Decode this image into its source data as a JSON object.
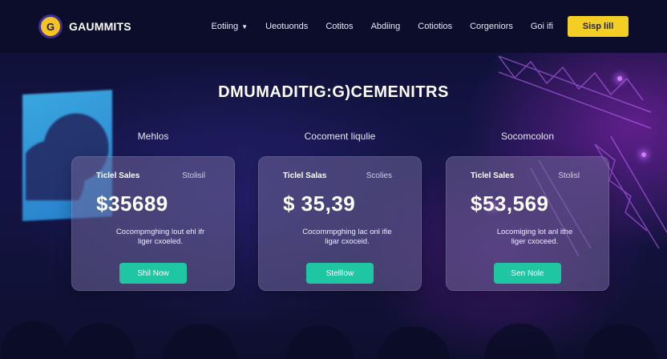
{
  "brand": {
    "logo_letter": "G",
    "name": "GAUMMITS"
  },
  "nav": {
    "items": [
      {
        "label": "Eotiing",
        "dropdown": true
      },
      {
        "label": "Ueotuonds"
      },
      {
        "label": "Cotitos"
      },
      {
        "label": "Abdiing"
      },
      {
        "label": "Cotiotios"
      },
      {
        "label": "Corgeniors"
      },
      {
        "label": "Goi ifi"
      }
    ],
    "signup_label": "Sisp lill"
  },
  "page_title": "DMUMADITIG:G)CEMENITRS",
  "columns": [
    {
      "heading": "Mehlos",
      "card": {
        "label": "Ticlel Sales",
        "tag": "Stolisil",
        "amount": "$35689",
        "description_line1": "Cocompmghing lout ehl ifr",
        "description_line2": "liger cxoeled.",
        "button": "Shil Now"
      }
    },
    {
      "heading": "Cocoment liqulie",
      "card": {
        "label": "Ticlel Salas",
        "tag": "Scolies",
        "amount": "$ 35,39",
        "description_line1": "Cocommpghing lac onl ifie",
        "description_line2": "ligar cxoceid.",
        "button": "Stelllow"
      }
    },
    {
      "heading": "Socomcolon",
      "card": {
        "label": "Ticlel Sales",
        "tag": "Stolisl",
        "amount": "$53,569",
        "description_line1": "Locomiging lot anl ithe",
        "description_line2": "liger cxoceed.",
        "button": "Sen Nole"
      }
    }
  ],
  "colors": {
    "accent_yellow": "#f3cf25",
    "button_teal": "#1ec7a1",
    "nav_bg": "#0b0d2b"
  }
}
